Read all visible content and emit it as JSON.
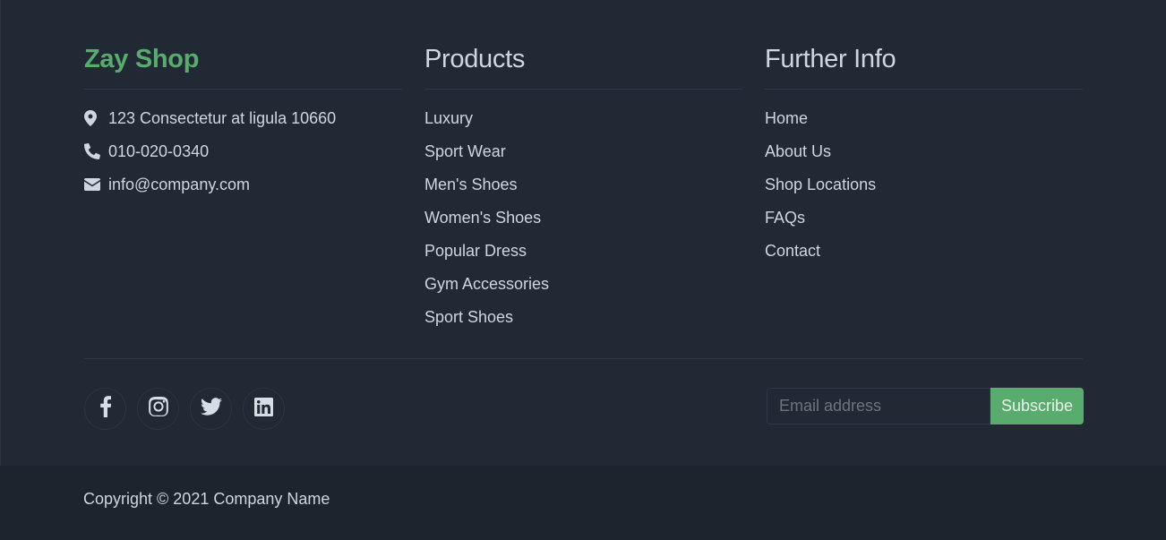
{
  "brand": {
    "name": "Zay Shop",
    "color": "#59ab6e"
  },
  "contact": [
    {
      "icon": "map-marker-icon",
      "text": "123 Consectetur at ligula 10660"
    },
    {
      "icon": "phone-icon",
      "text": "010-020-0340"
    },
    {
      "icon": "envelope-icon",
      "text": "info@company.com"
    }
  ],
  "products": {
    "heading": "Products",
    "items": [
      "Luxury",
      "Sport Wear",
      "Men's Shoes",
      "Women's Shoes",
      "Popular Dress",
      "Gym Accessories",
      "Sport Shoes"
    ]
  },
  "further_info": {
    "heading": "Further Info",
    "items": [
      "Home",
      "About Us",
      "Shop Locations",
      "FAQs",
      "Contact"
    ]
  },
  "social": [
    "facebook-icon",
    "instagram-icon",
    "twitter-icon",
    "linkedin-icon"
  ],
  "subscribe": {
    "placeholder": "Email address",
    "button_label": "Subscribe"
  },
  "copyright": "Copyright © 2021 Company Name",
  "colors": {
    "background": "#212934",
    "bottom_bar": "#1d242d",
    "accent": "#59ab6e",
    "text": "#cfd6e1"
  }
}
